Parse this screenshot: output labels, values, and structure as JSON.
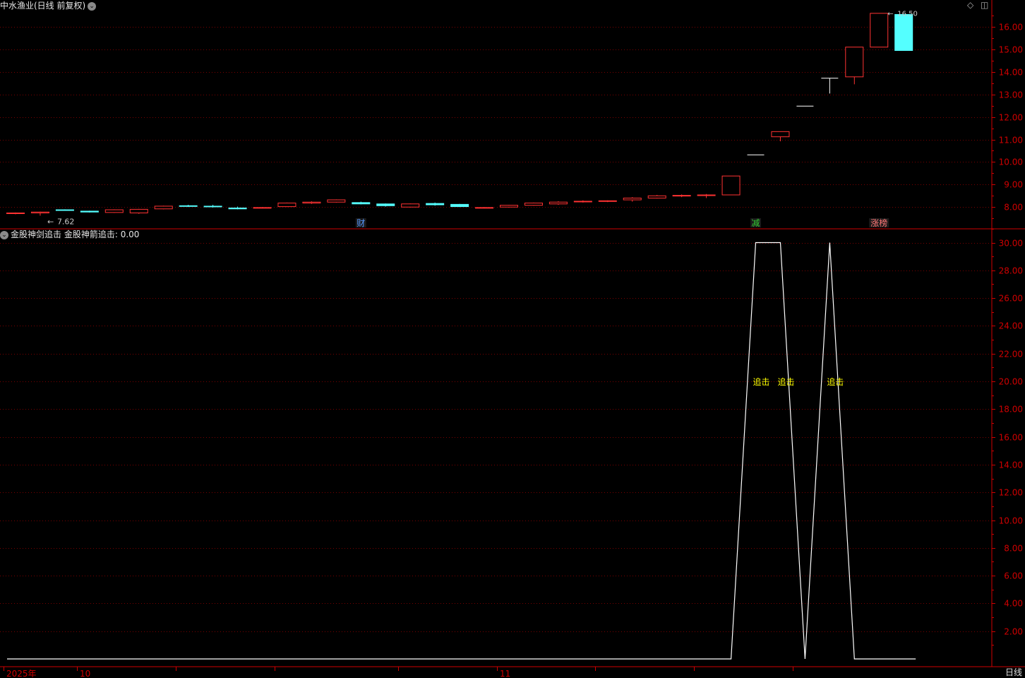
{
  "window": {
    "title": "中水渔业(日线 前复权)",
    "collapse_icon": "chevron-down-icon",
    "tool_icons": [
      "diamond-icon",
      "panel-icon"
    ],
    "period_label": "日线"
  },
  "colors": {
    "up": "#ff3232",
    "down": "#54ffff",
    "grid": "#7a0000",
    "axis": "#d00000",
    "line": "#ffffff",
    "label": "#ffff00"
  },
  "price_panel": {
    "ticks": [
      "16.00",
      "15.00",
      "14.00",
      "13.00",
      "12.00",
      "11.00",
      "10.00",
      "9.00",
      "8.00"
    ],
    "low_annotation": "7.62",
    "high_annotation": "16.50",
    "candles": [
      {
        "o": 7.72,
        "h": 7.76,
        "l": 7.68,
        "c": 7.74
      },
      {
        "o": 7.74,
        "h": 7.8,
        "l": 7.62,
        "c": 7.78
      },
      {
        "o": 7.88,
        "h": 7.9,
        "l": 7.84,
        "c": 7.86
      },
      {
        "o": 7.82,
        "h": 7.84,
        "l": 7.76,
        "c": 7.78
      },
      {
        "o": 7.76,
        "h": 7.9,
        "l": 7.74,
        "c": 7.88
      },
      {
        "o": 7.74,
        "h": 7.92,
        "l": 7.7,
        "c": 7.9
      },
      {
        "o": 7.92,
        "h": 8.06,
        "l": 7.9,
        "c": 8.04
      },
      {
        "o": 8.06,
        "h": 8.1,
        "l": 8.0,
        "c": 8.04
      },
      {
        "o": 8.04,
        "h": 8.1,
        "l": 7.98,
        "c": 8.02
      },
      {
        "o": 7.96,
        "h": 8.02,
        "l": 7.9,
        "c": 7.92
      },
      {
        "o": 7.96,
        "h": 8.0,
        "l": 7.94,
        "c": 7.98
      },
      {
        "o": 8.02,
        "h": 8.2,
        "l": 8.0,
        "c": 8.18
      },
      {
        "o": 8.18,
        "h": 8.26,
        "l": 8.14,
        "c": 8.22
      },
      {
        "o": 8.22,
        "h": 8.34,
        "l": 8.2,
        "c": 8.32
      },
      {
        "o": 8.2,
        "h": 8.24,
        "l": 8.12,
        "c": 8.14
      },
      {
        "o": 8.14,
        "h": 8.16,
        "l": 8.02,
        "c": 8.06
      },
      {
        "o": 8.0,
        "h": 8.16,
        "l": 7.98,
        "c": 8.14
      },
      {
        "o": 8.16,
        "h": 8.2,
        "l": 8.06,
        "c": 8.1
      },
      {
        "o": 8.12,
        "h": 8.14,
        "l": 8.0,
        "c": 8.02
      },
      {
        "o": 7.96,
        "h": 8.0,
        "l": 7.94,
        "c": 7.98
      },
      {
        "o": 8.0,
        "h": 8.1,
        "l": 7.98,
        "c": 8.08
      },
      {
        "o": 8.08,
        "h": 8.2,
        "l": 8.06,
        "c": 8.18
      },
      {
        "o": 8.14,
        "h": 8.26,
        "l": 8.1,
        "c": 8.22
      },
      {
        "o": 8.24,
        "h": 8.3,
        "l": 8.2,
        "c": 8.26
      },
      {
        "o": 8.26,
        "h": 8.3,
        "l": 8.22,
        "c": 8.28
      },
      {
        "o": 8.32,
        "h": 8.44,
        "l": 8.24,
        "c": 8.4
      },
      {
        "o": 8.4,
        "h": 8.54,
        "l": 8.38,
        "c": 8.5
      },
      {
        "o": 8.5,
        "h": 8.56,
        "l": 8.44,
        "c": 8.52
      },
      {
        "o": 8.52,
        "h": 8.58,
        "l": 8.4,
        "c": 8.54
      },
      {
        "o": 8.54,
        "h": 9.38,
        "l": 8.54,
        "c": 9.38
      },
      {
        "o": 10.32,
        "h": 10.32,
        "l": 10.32,
        "c": 10.32
      },
      {
        "o": 11.12,
        "h": 11.35,
        "l": 10.92,
        "c": 11.35
      },
      {
        "o": 12.48,
        "h": 12.48,
        "l": 12.48,
        "c": 12.48
      },
      {
        "o": 13.72,
        "h": 13.72,
        "l": 13.04,
        "c": 13.72
      },
      {
        "o": 13.78,
        "h": 15.1,
        "l": 13.45,
        "c": 15.1
      },
      {
        "o": 15.1,
        "h": 16.6,
        "l": 15.1,
        "c": 16.6
      },
      {
        "o": 16.55,
        "h": 16.55,
        "l": 14.95,
        "c": 14.95
      }
    ],
    "event_marks": [
      {
        "index": 14,
        "label": "财",
        "color": "#5599ff"
      },
      {
        "index": 30,
        "label": "减",
        "color": "#33cc33"
      },
      {
        "index": 35,
        "label": "涨榜",
        "color": "#ff7777"
      }
    ]
  },
  "indicator_panel": {
    "name": "金股神剑追击",
    "series_label": "金股神箭追击:",
    "series_value": "0.00",
    "ticks": [
      "30.00",
      "28.00",
      "26.00",
      "24.00",
      "22.00",
      "20.00",
      "18.00",
      "16.00",
      "14.00",
      "12.00",
      "10.00",
      "8.00",
      "6.00",
      "4.00",
      "2.00"
    ],
    "signal_text": "追击",
    "signal_level": 20,
    "signal_indices": [
      30,
      31,
      33
    ],
    "values": [
      0,
      0,
      0,
      0,
      0,
      0,
      0,
      0,
      0,
      0,
      0,
      0,
      0,
      0,
      0,
      0,
      0,
      0,
      0,
      0,
      0,
      0,
      0,
      0,
      0,
      0,
      0,
      0,
      0,
      0,
      30,
      30,
      0,
      30,
      0,
      0,
      0
    ]
  },
  "time_axis": {
    "labels": [
      {
        "index": 0,
        "text": "2025年"
      },
      {
        "index": 3,
        "text": "10"
      },
      {
        "index": 20,
        "text": "11"
      }
    ]
  }
}
